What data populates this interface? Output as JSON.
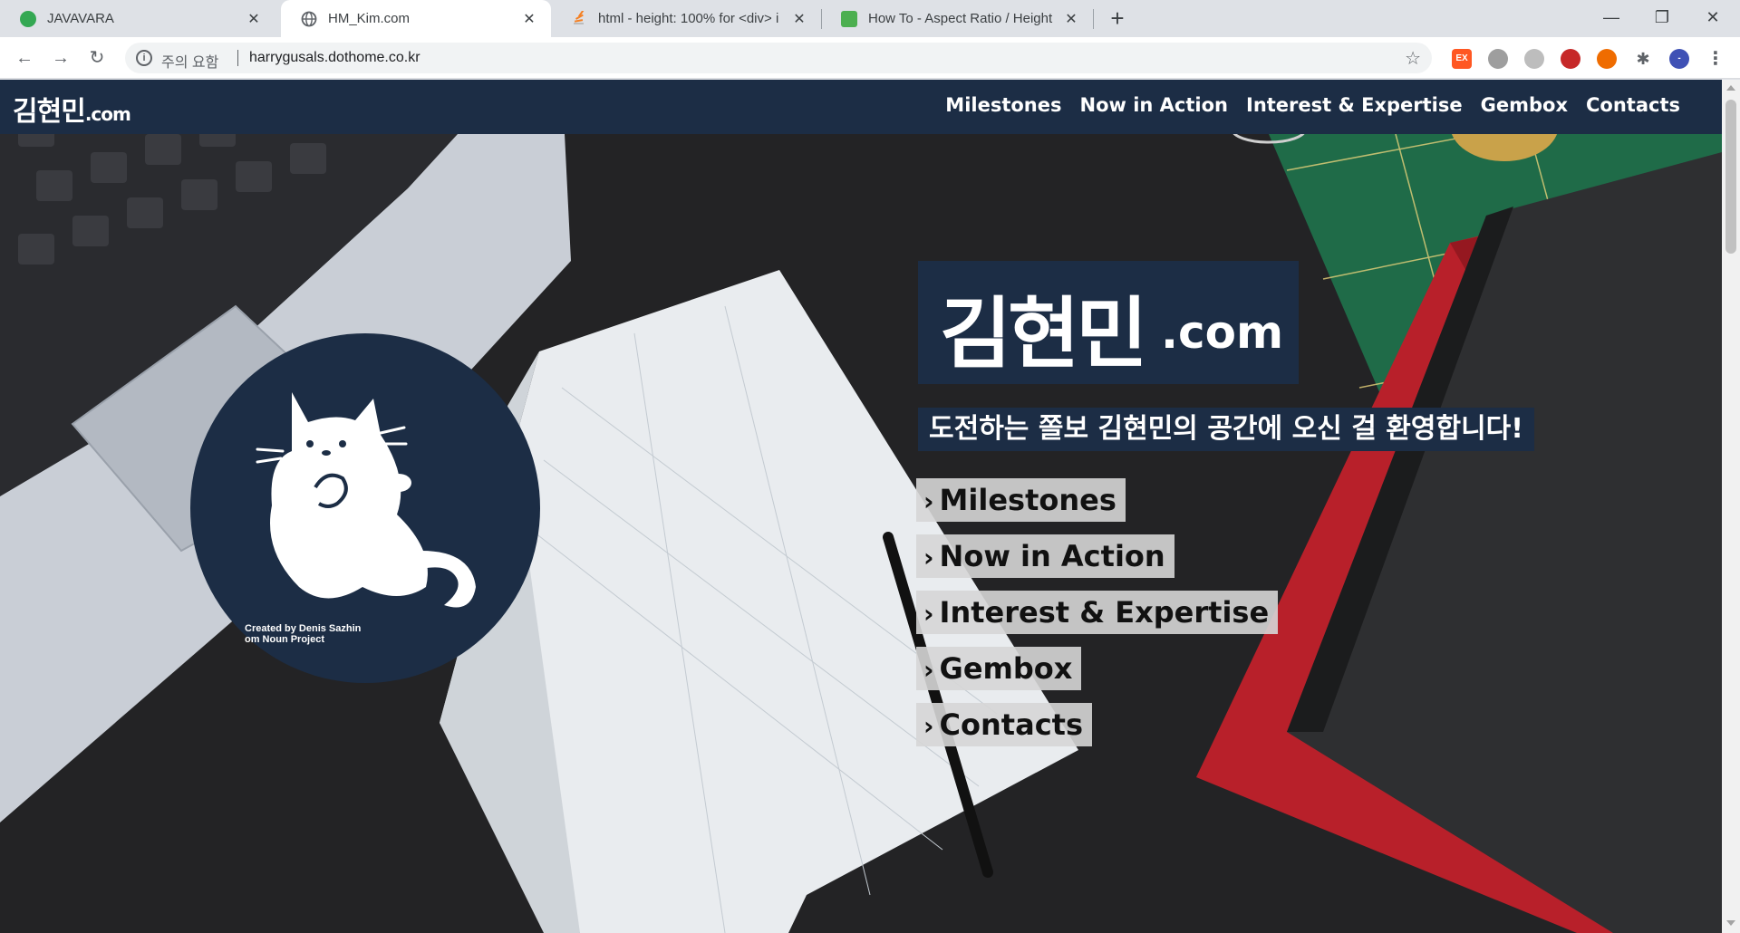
{
  "browser": {
    "tabs": [
      {
        "title": "JAVAVARA",
        "favicon_color": "#34a853",
        "active": false
      },
      {
        "title": "HM_Kim.com",
        "favicon_color": "#5f6368",
        "active": true
      },
      {
        "title": "html - height: 100% for <div> i",
        "favicon_color": "#f48024",
        "active": false
      },
      {
        "title": "How To - Aspect Ratio / Height",
        "favicon_color": "#4caf50",
        "active": false
      }
    ],
    "close_glyph": "✕",
    "new_tab_glyph": "+",
    "window_controls": {
      "minimize": "—",
      "restore": "❐",
      "close": "✕"
    },
    "nav": {
      "back": "←",
      "forward": "→",
      "reload": "↻"
    },
    "address": {
      "security_icon": "i",
      "security_label": "주의 요함",
      "url": "harrygusals.dothome.co.kr",
      "bookmark_icon": "☆"
    },
    "extensions": [
      {
        "name": "ex-extension-icon",
        "label": "EX",
        "color": "#ff5722"
      },
      {
        "name": "gray-extension-icon",
        "label": "",
        "color": "#9e9e9e"
      },
      {
        "name": "circle-extension-icon",
        "label": "",
        "color": "#bdbdbd"
      },
      {
        "name": "eyedropper-extension-icon",
        "label": "",
        "color": "#c62828"
      },
      {
        "name": "hammer-extension-icon",
        "label": "",
        "color": "#ef6c00"
      },
      {
        "name": "puzzle-extension-icon",
        "label": "✱",
        "color": "#5f6368"
      },
      {
        "name": "profile-avatar-icon",
        "label": "-",
        "color": "#3f51b5"
      },
      {
        "name": "menu-kebab-icon",
        "label": "⋮",
        "color": "#ffffff"
      }
    ]
  },
  "site": {
    "header": {
      "logo_main": "김현민",
      "logo_suffix": ".com",
      "nav": [
        "Milestones",
        "Now in Action",
        "Interest & Expertise",
        "Gembox",
        "Contacts"
      ]
    },
    "hero": {
      "logo_main": "김현민",
      "logo_suffix": ".com",
      "welcome": "도전하는 쫄보 김현민의 공간에 오신 걸 환영합니다!",
      "menu": [
        "Milestones",
        "Now in Action",
        "Interest & Expertise",
        "Gembox",
        "Contacts"
      ],
      "chevron": "›"
    },
    "credit_lines": [
      "Created by Denis Sazhin",
      "om Noun Project"
    ],
    "colors": {
      "brand_navy": "#1c2d45",
      "menu_bg": "#d6d6d6"
    }
  }
}
